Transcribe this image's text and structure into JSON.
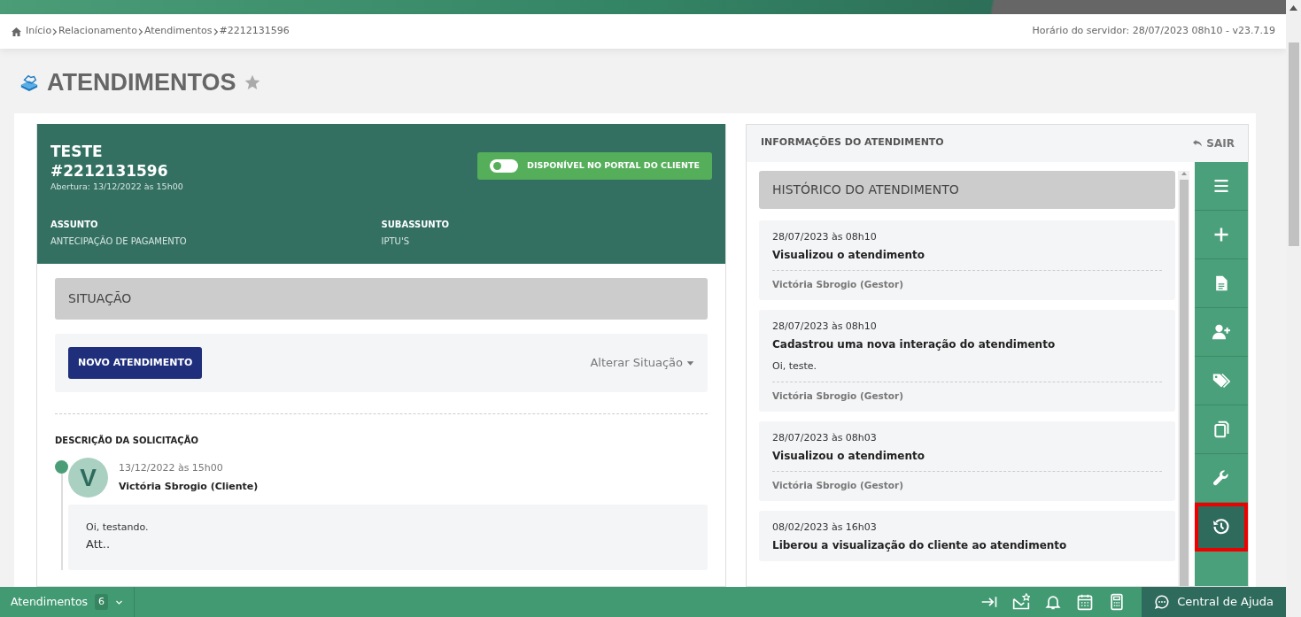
{
  "breadcrumb": [
    {
      "label": "Início",
      "kind": "home"
    },
    {
      "label": "Relacionamento",
      "kind": "link"
    },
    {
      "label": "Atendimentos",
      "kind": "link"
    },
    {
      "label": "#2212131596",
      "kind": "current"
    }
  ],
  "server_info": "Horário do servidor: 28/07/2023 08h10 - v23.7.19",
  "page_title": "ATENDIMENTOS",
  "favorite": false,
  "ticket": {
    "title": "TESTE",
    "number": "#2212131596",
    "opened": "Abertura: 13/12/2022 às 15h00",
    "portal_toggle": {
      "label": "DISPONÍVEL NO PORTAL DO CLIENTE",
      "on": false
    },
    "fields": [
      {
        "label": "ASSUNTO",
        "value": "ANTECIPAÇÃO DE PAGAMENTO"
      },
      {
        "label": "SUBASSUNTO",
        "value": "IPTU'S"
      }
    ]
  },
  "situation": {
    "heading": "SITUAÇÃO",
    "button": "NOVO ATENDIMENTO",
    "change_link": "Alterar Situação"
  },
  "description": {
    "heading": "DESCRIÇÃO DA SOLICITAÇÃO",
    "entries": [
      {
        "initial": "V",
        "date": "13/12/2022 às 15h00",
        "author": "Victória Sbrogio (Cliente)",
        "lines": [
          "Oi, testando.",
          "Att.."
        ]
      }
    ]
  },
  "info_panel": {
    "title": "INFORMAÇÕES DO ATENDIMENTO",
    "exit": "SAIR",
    "history_heading": "HISTÓRICO DO ATENDIMENTO",
    "history": [
      {
        "date": "28/07/2023 às 08h10",
        "action": "Visualizou o atendimento",
        "author": "Victória Sbrogio (Gestor)"
      },
      {
        "date": "28/07/2023 às 08h10",
        "action": "Cadastrou uma nova interação do atendimento",
        "note": "Oi, teste.",
        "author": "Victória Sbrogio (Gestor)"
      },
      {
        "date": "28/07/2023 às 08h03",
        "action": "Visualizou o atendimento",
        "author": "Victória Sbrogio (Gestor)"
      },
      {
        "date": "08/02/2023 às 16h03",
        "action": "Liberou a visualização do cliente ao atendimento"
      }
    ],
    "tools": [
      {
        "kind": "menu",
        "selected": false
      },
      {
        "kind": "add",
        "selected": false
      },
      {
        "kind": "document",
        "selected": false
      },
      {
        "kind": "add-user",
        "selected": false
      },
      {
        "kind": "tags",
        "selected": false
      },
      {
        "kind": "copy",
        "selected": false
      },
      {
        "kind": "wrench",
        "selected": false
      },
      {
        "kind": "history",
        "selected": true
      }
    ]
  },
  "bottom_bar": {
    "module": "Atendimentos",
    "count": "6",
    "icons": [
      {
        "kind": "collapse"
      },
      {
        "kind": "mail"
      },
      {
        "kind": "bell"
      },
      {
        "kind": "calendar"
      },
      {
        "kind": "calculator"
      }
    ],
    "help": "Central de Ajuda"
  }
}
